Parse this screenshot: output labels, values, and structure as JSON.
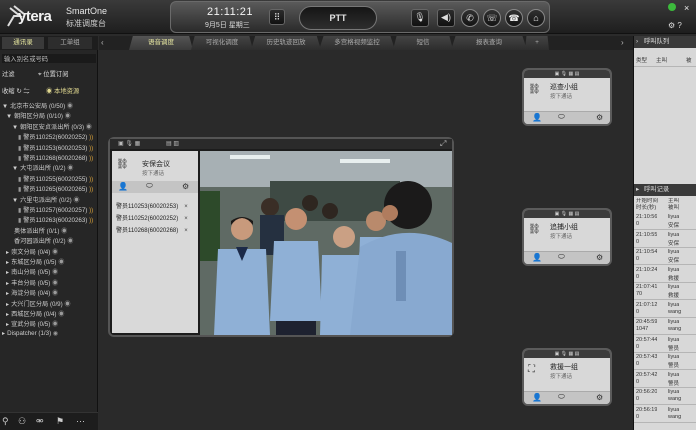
{
  "app": {
    "brand": "ytera",
    "name": "SmartOne",
    "subtitle": "标准调度台",
    "time": "21:11:21",
    "date": "9月5日 星期三",
    "ptt_label": "PTT"
  },
  "tabs": [
    {
      "label": "语音调度",
      "active": true
    },
    {
      "label": "可视化调度",
      "active": false
    },
    {
      "label": "历史轨迹回放",
      "active": false
    },
    {
      "label": "多宫格视频监控",
      "active": false
    },
    {
      "label": "短信",
      "active": false
    },
    {
      "label": "报表查询",
      "active": false
    },
    {
      "label": "+",
      "active": false
    }
  ],
  "left": {
    "tabs": [
      "通讯录",
      "工单组"
    ],
    "search_placeholder": "输入别名或号码",
    "filter_label": "过滤",
    "location_label": "位置订阅",
    "collapse_label": "收缩",
    "local_resource_label": "本地资源",
    "tree": [
      {
        "label": "北京市公安局 (0/50)",
        "level": 0,
        "expand": "▼"
      },
      {
        "label": "朝阳区分局 (0/10)",
        "level": 1,
        "expand": "▼"
      },
      {
        "label": "朝阳区安贞派出所 (0/3)",
        "level": 2,
        "expand": "▼"
      },
      {
        "label": "警员110252(60020252)",
        "level": 3,
        "expand": ""
      },
      {
        "label": "警员110253(60020253)",
        "level": 3,
        "expand": ""
      },
      {
        "label": "警员110268(60020268)",
        "level": 3,
        "expand": ""
      },
      {
        "label": "大屯派出所 (0/2)",
        "level": 2,
        "expand": "▼"
      },
      {
        "label": "警员110255(60020255)",
        "level": 3,
        "expand": ""
      },
      {
        "label": "警员110265(60020265)",
        "level": 3,
        "expand": ""
      },
      {
        "label": "六里屯派出所 (0/2)",
        "level": 2,
        "expand": "▼"
      },
      {
        "label": "警员110257(60020257)",
        "level": 3,
        "expand": ""
      },
      {
        "label": "警员110263(60020263)",
        "level": 3,
        "expand": ""
      },
      {
        "label": "奥体派出所 (0/1)",
        "level": 2,
        "expand": ""
      },
      {
        "label": "香河园派出所 (0/2)",
        "level": 2,
        "expand": ""
      },
      {
        "label": "崇文分局 (0/4)",
        "level": 1,
        "expand": "▸"
      },
      {
        "label": "东城区分局 (0/5)",
        "level": 1,
        "expand": "▸"
      },
      {
        "label": "南山分局 (0/5)",
        "level": 1,
        "expand": "▸"
      },
      {
        "label": "丰台分局 (0/5)",
        "level": 1,
        "expand": "▸"
      },
      {
        "label": "海淀分局 (0/4)",
        "level": 1,
        "expand": "▸"
      },
      {
        "label": "大兴门区分局 (0/9)",
        "level": 1,
        "expand": "▸"
      },
      {
        "label": "西城区分局 (0/4)",
        "level": 1,
        "expand": "▸"
      },
      {
        "label": "宣武分局 (0/5)",
        "level": 1,
        "expand": "▸"
      },
      {
        "label": "Dispatcher (1/3)",
        "level": 0,
        "expand": "▸"
      }
    ]
  },
  "groups": [
    {
      "title": "巡查小组",
      "subtitle": "按下通话"
    },
    {
      "title": "追捕小组",
      "subtitle": "按下通话"
    },
    {
      "title": "救援一组",
      "subtitle": "按下通话"
    }
  ],
  "video_window": {
    "title": "安保会议",
    "subtitle": "按下通话",
    "members": [
      "警员110253(60020253)",
      "警员110252(60020252)",
      "警员110268(60020268)"
    ]
  },
  "right": {
    "queue_title": "呼叫队列",
    "queue_cols": [
      "类型",
      "主叫",
      "被"
    ],
    "log_title": "呼叫记录",
    "log_cols": [
      "开始时间\n时长(秒)",
      "主叫\n被叫"
    ],
    "log_rows": [
      {
        "t": "21:10:56",
        "d": "0",
        "c": "liyua",
        "s": "安保"
      },
      {
        "t": "21:10:55",
        "d": "0",
        "c": "liyua",
        "s": "安保"
      },
      {
        "t": "21:10:54",
        "d": "0",
        "c": "liyua",
        "s": "安保"
      },
      {
        "t": "21:10:24",
        "d": "0",
        "c": "liyua",
        "s": "救援"
      },
      {
        "t": "21:07:41",
        "d": "70",
        "c": "liyua",
        "s": "救援"
      },
      {
        "t": "21:07:12",
        "d": "0",
        "c": "liyua",
        "s": "wang"
      },
      {
        "t": "20:45:59",
        "d": "1047",
        "c": "liyua",
        "s": "wang"
      },
      {
        "t": "20:57:44",
        "d": "0",
        "c": "liyua",
        "s": "警员"
      },
      {
        "t": "20:57:43",
        "d": "0",
        "c": "liyua",
        "s": "警员"
      },
      {
        "t": "20:57:42",
        "d": "0",
        "c": "liyua",
        "s": "警员"
      },
      {
        "t": "20:56:20",
        "d": "0",
        "c": "liyua",
        "s": "wang"
      },
      {
        "t": "20:56:19",
        "d": "0",
        "c": "liyua",
        "s": "wang"
      }
    ]
  }
}
